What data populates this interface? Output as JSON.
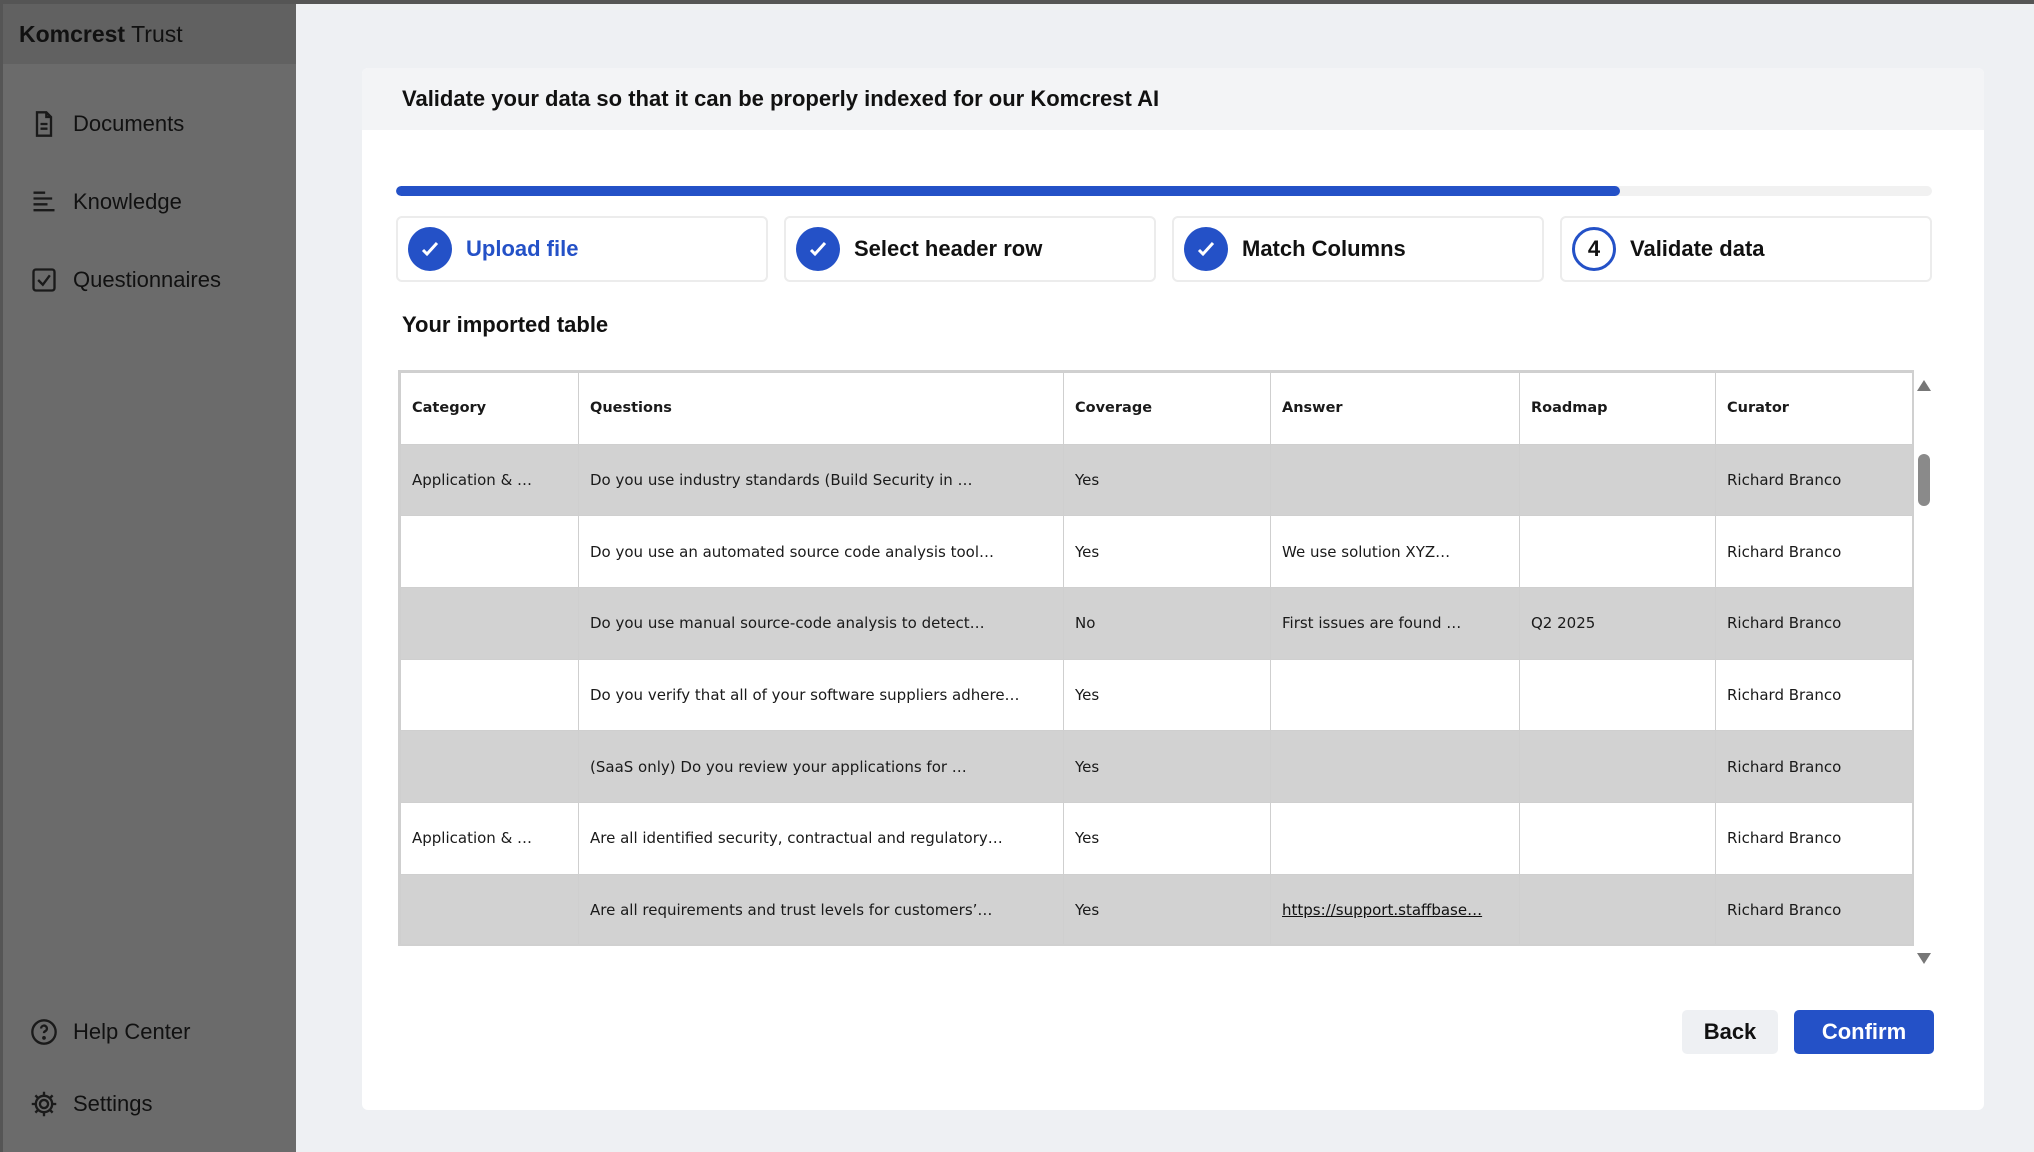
{
  "app": {
    "brand_bold": "Komcrest",
    "brand_rest": "Trust"
  },
  "sidebar": {
    "items": [
      {
        "label": "Documents",
        "icon": "document-icon"
      },
      {
        "label": "Knowledge",
        "icon": "list-icon"
      },
      {
        "label": "Questionnaires",
        "icon": "checkbox-icon"
      }
    ],
    "bottom_items": [
      {
        "label": "Help Center",
        "icon": "help-icon"
      },
      {
        "label": "Settings",
        "icon": "gear-icon"
      }
    ]
  },
  "header": {
    "title": "Validate your data so that it can be properly indexed for our Komcrest AI"
  },
  "progress": {
    "fraction": 0.797
  },
  "steps": [
    {
      "label": "Upload file",
      "state": "done-active"
    },
    {
      "label": "Select header row",
      "state": "done"
    },
    {
      "label": "Match Columns",
      "state": "done"
    },
    {
      "number": "4",
      "label": "Validate data",
      "state": "current"
    }
  ],
  "section_title": "Your imported table",
  "table": {
    "headers": [
      "Category",
      "Questions",
      "Coverage",
      "Answer",
      "Roadmap",
      "Curator"
    ],
    "rows": [
      [
        "Application & …",
        "Do you use industry standards (Build Security in …",
        "Yes",
        "",
        "",
        " Richard Branco"
      ],
      [
        "",
        "Do you use an automated source code analysis tool…",
        "Yes",
        " We use solution XYZ…",
        "",
        "Richard Branco"
      ],
      [
        "",
        "Do you use manual source-code analysis to detect…",
        "No",
        " First issues are found …",
        "Q2 2025",
        "Richard Branco"
      ],
      [
        "",
        "Do you verify that all of your software suppliers adhere…",
        "Yes",
        "",
        "",
        "Richard Branco"
      ],
      [
        "",
        "(SaaS only) Do you review your applications for …",
        "Yes",
        "",
        "",
        "Richard Branco"
      ],
      [
        "Application & …",
        "Are all identified security, contractual and regulatory…",
        "Yes",
        "",
        "",
        "Richard Branco"
      ],
      [
        "",
        "Are all requirements and trust levels for customers’…",
        "Yes",
        "https://support.staffbase…",
        "",
        "Richard Branco"
      ]
    ]
  },
  "buttons": {
    "back": "Back",
    "confirm": "Confirm"
  },
  "colors": {
    "accent": "#2451c7",
    "sidebar": "#6b6b6b",
    "row_shade": "#d2d2d2"
  }
}
